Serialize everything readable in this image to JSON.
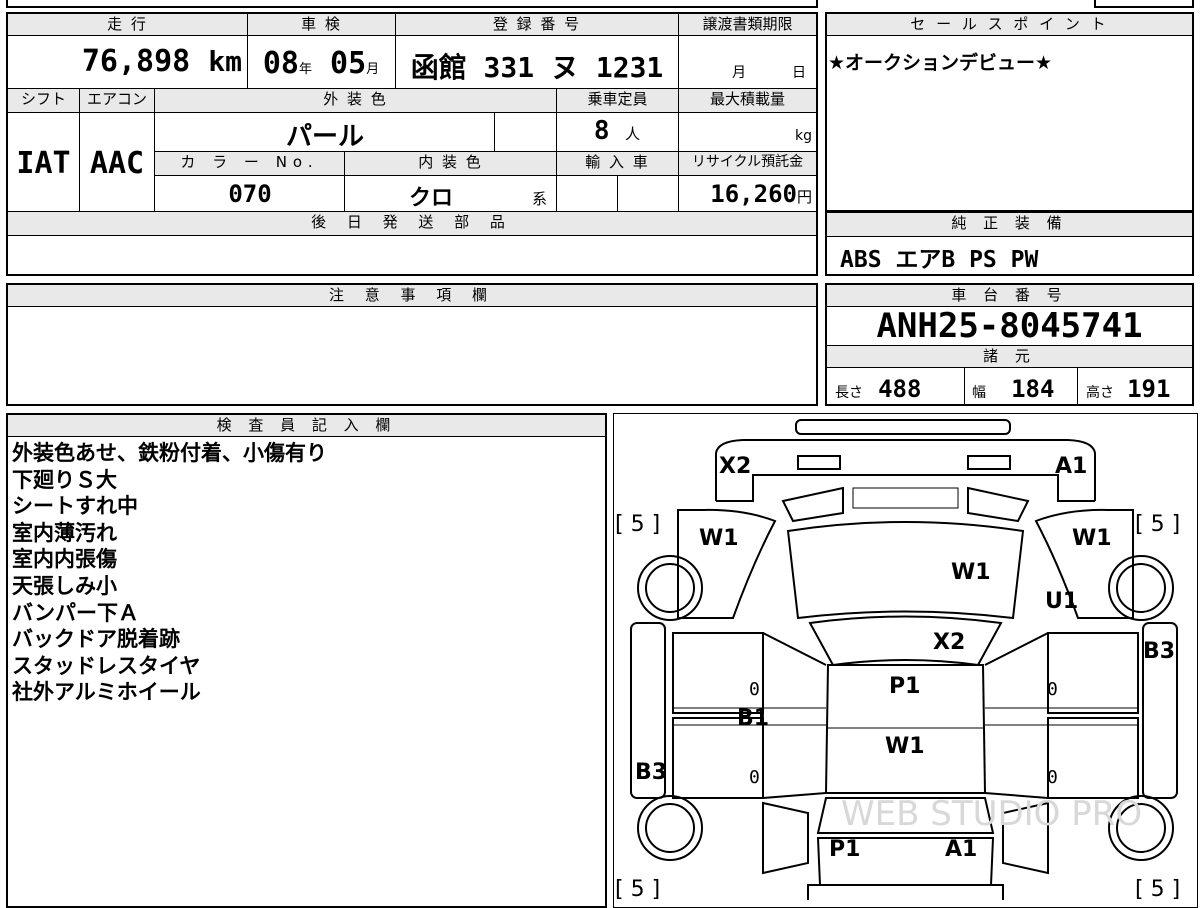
{
  "top_left": {
    "mileage": {
      "label": "走 行",
      "value": "76,898",
      "unit": "km"
    },
    "inspection": {
      "label": "車 検",
      "year": "08",
      "year_unit": "年",
      "month": "05",
      "month_unit": "月"
    },
    "registration": {
      "label": "登 録 番 号",
      "value": "函館 331 ヌ 1231"
    },
    "transfer_deadline": {
      "label": "譲渡書類期限",
      "month_unit": "月",
      "day_unit": "日"
    },
    "shift": {
      "label": "シフト",
      "value": "IAT"
    },
    "aircon": {
      "label": "エアコン",
      "value": "AAC"
    },
    "exterior_color": {
      "label": "外 装 色",
      "value": "パール"
    },
    "capacity": {
      "label": "乗車定員",
      "value": "8",
      "unit": "人"
    },
    "max_load": {
      "label": "最大積載量",
      "unit": "kg"
    },
    "color_no": {
      "label": "カ ラ ー No.",
      "value": "070"
    },
    "interior_color": {
      "label": "内 装 色",
      "value": "クロ",
      "suffix": "系"
    },
    "import": {
      "label": "輸 入 車"
    },
    "recycle_fee": {
      "label": "リサイクル預託金",
      "value": "16,260",
      "unit": "円"
    },
    "later_parts": {
      "label": "後 日 発 送 部 品"
    }
  },
  "sales_point": {
    "label": "セ ー ル ス ポ イ ン ト",
    "text": "★オークションデビュー★"
  },
  "genuine_equipment": {
    "label": "純 正 装 備",
    "text": "ABS エアB PS PW"
  },
  "caution": {
    "label": "注 意 事 項 欄"
  },
  "chassis": {
    "label": "車 台 番 号",
    "value": "ANH25-8045741"
  },
  "specs": {
    "label": "諸 元",
    "length_label": "長さ",
    "length": "488",
    "width_label": "幅",
    "width": "184",
    "height_label": "高さ",
    "height": "191"
  },
  "inspector": {
    "label": "検 査 員 記 入 欄",
    "notes": [
      "外装色あせ、鉄粉付着、小傷有り",
      "下廻りＳ大",
      "シートすれ中",
      "室内薄汚れ",
      "室内内張傷",
      "天張しみ小",
      "バンパー下Ａ",
      "バックドア脱着跡",
      "スタッドレスタイヤ",
      "社外アルミホイール"
    ]
  },
  "diagram": {
    "marks": {
      "front_left": "X2",
      "front_right": "A1",
      "fender_left": "W1",
      "fender_right": "W1",
      "hood": "W1",
      "fender_right_lower": "U1",
      "windshield_area": "X2",
      "roof_front": "P1",
      "roof_rear": "W1",
      "side_left": "B1",
      "side_left_rear": "B3",
      "side_right": "B3",
      "rear_left": "P1",
      "rear_right": "A1"
    },
    "tire_marks": {
      "front_left": "[ 5 ]",
      "front_right": "[ 5 ]",
      "rear_left": "[ 5 ]",
      "rear_right": "[ 5 ]"
    },
    "door_zero": "0",
    "watermark": "WEB STUDIO PRO"
  }
}
